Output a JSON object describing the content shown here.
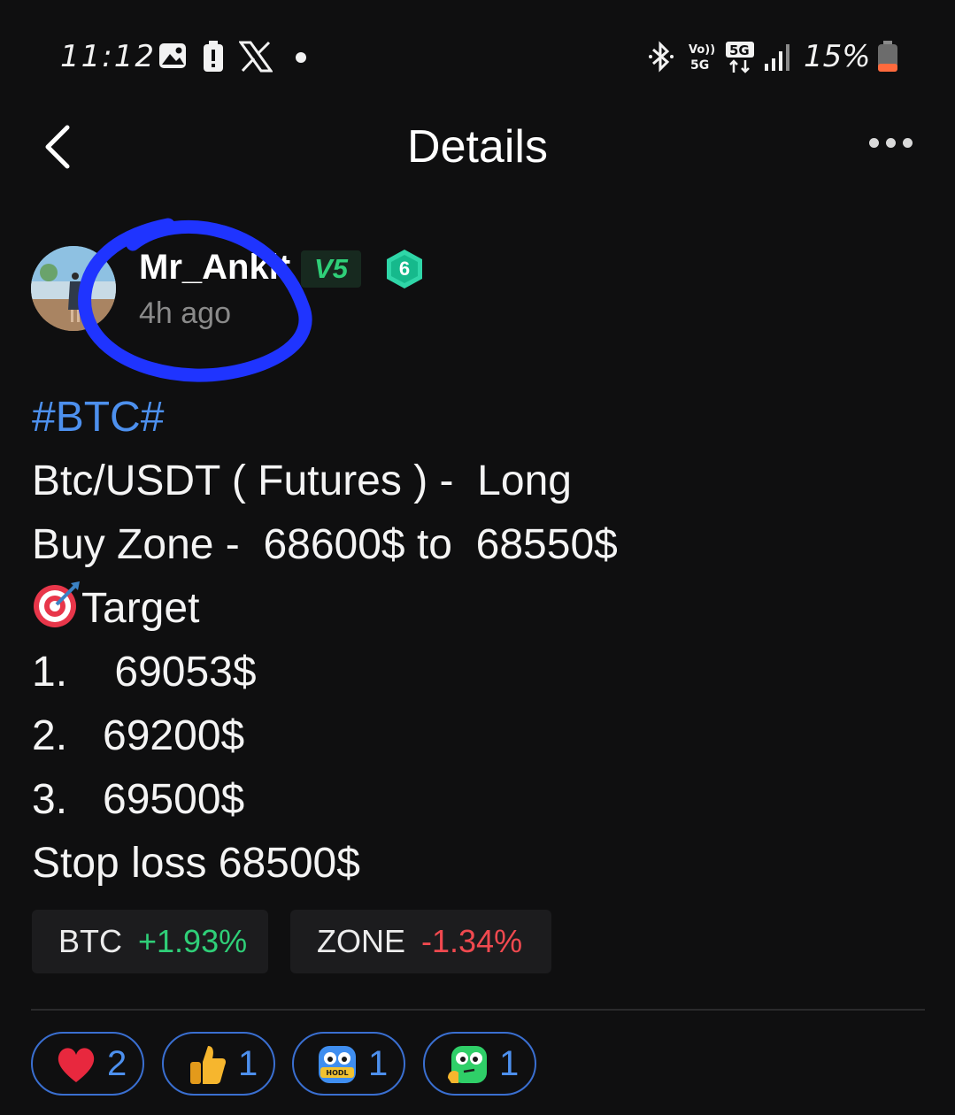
{
  "status_bar": {
    "time": "11:12",
    "battery": "15%",
    "icons": [
      "gallery-icon",
      "battery-alert-icon",
      "x-icon",
      "dot-icon",
      "bluetooth-icon",
      "volte-icon",
      "5g-icon",
      "signal-icon",
      "battery-icon"
    ]
  },
  "nav": {
    "title": "Details",
    "back_icon": "chevron-left-icon",
    "more_icon": "more-horizontal-icon"
  },
  "author": {
    "name": "Mr_Ankit",
    "vip": "V5",
    "level": "6",
    "time": "4h ago"
  },
  "post": {
    "hashtag": "#BTC#",
    "lines": [
      "Btc/USDT ( Futures ) -  Long",
      "Buy Zone -  68600$ to  68550$",
      "Target",
      "1.    69053$",
      "2.   69200$",
      "3.   69500$",
      "Stop loss 68500$"
    ],
    "target_icon": "target-icon"
  },
  "coins": [
    {
      "symbol": "BTC",
      "change": "+1.93%",
      "direction": "up"
    },
    {
      "symbol": "ZONE",
      "change": "-1.34%",
      "direction": "down"
    }
  ],
  "reactions": [
    {
      "icon": "heart-icon",
      "count": "2"
    },
    {
      "icon": "thumbs-up-icon",
      "count": "1"
    },
    {
      "icon": "hodl-icon",
      "count": "1"
    },
    {
      "icon": "thinking-icon",
      "count": "1"
    }
  ],
  "colors": {
    "background": "#0f0f10",
    "accent_blue": "#4d90ee",
    "up_green": "#2fcf78",
    "down_red": "#f0494f",
    "highlight_marker": "#1f34ff"
  }
}
